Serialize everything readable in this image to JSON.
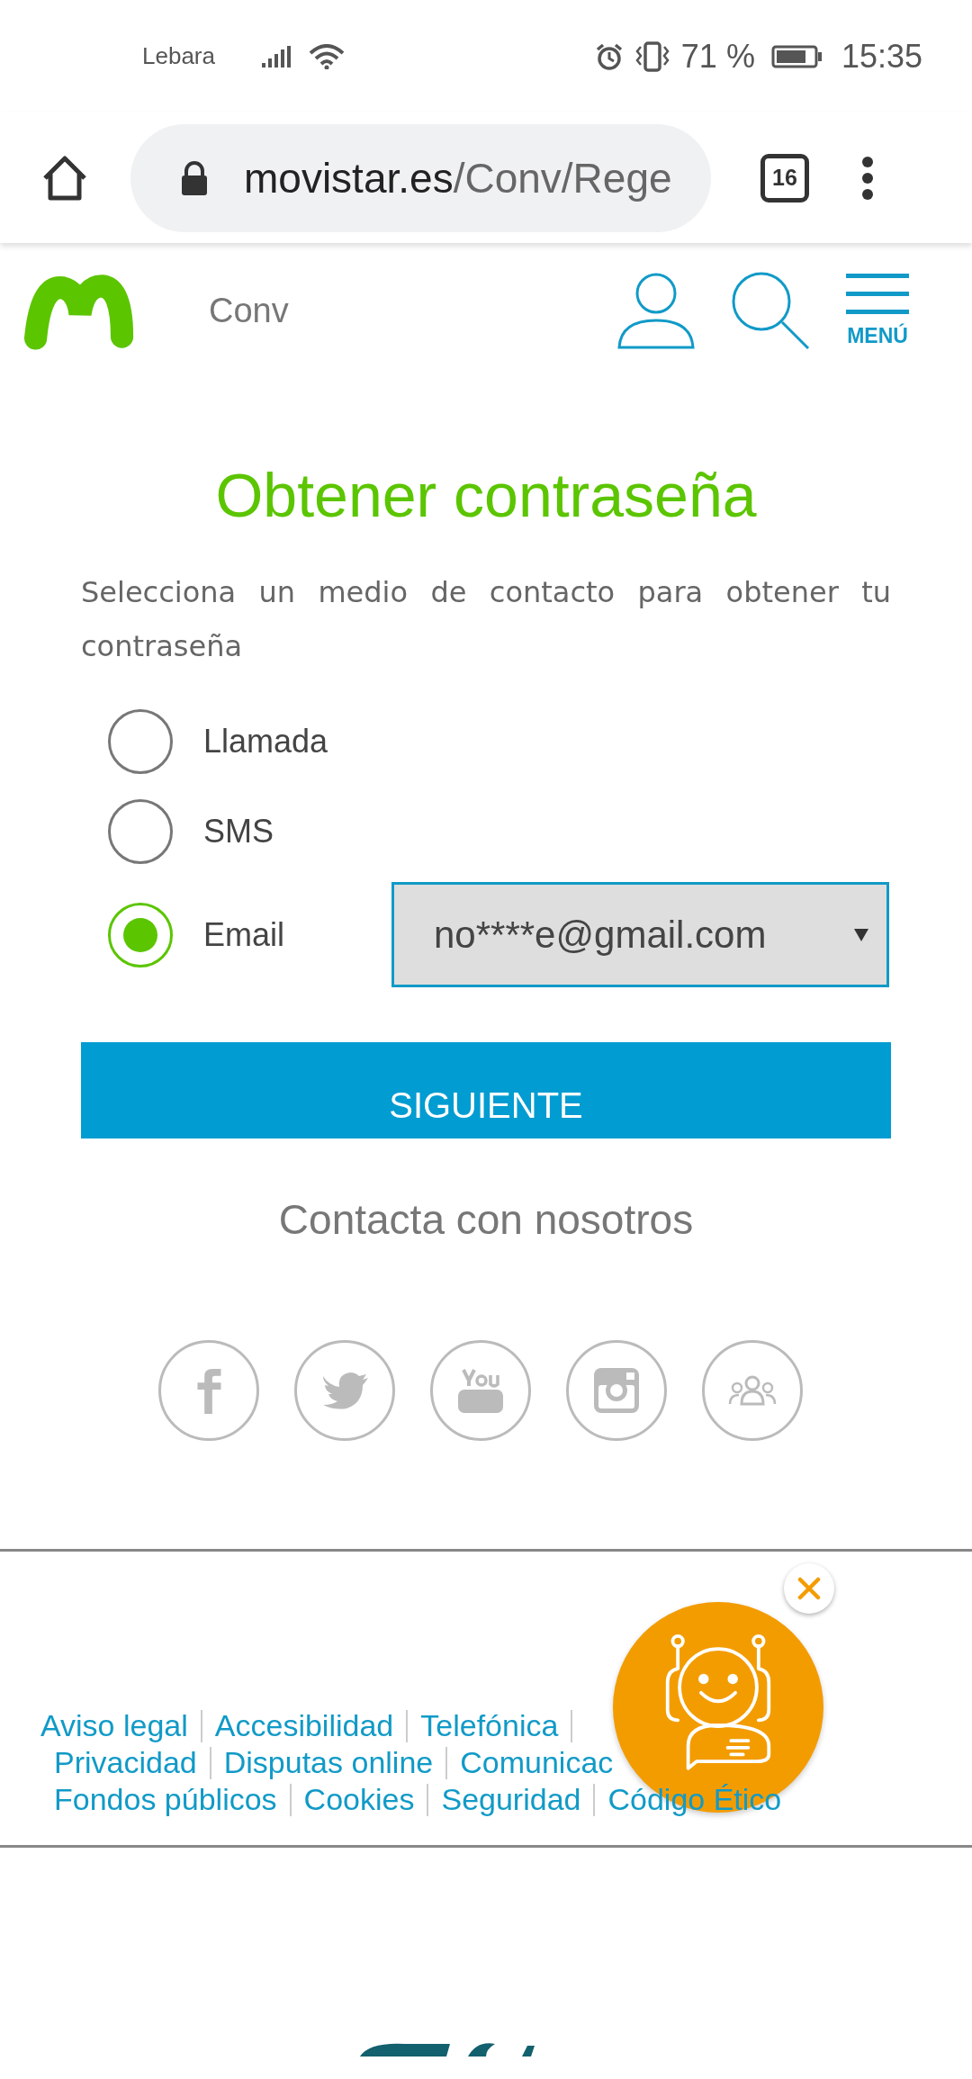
{
  "status_bar": {
    "carrier": "Lebara",
    "battery": "71 %",
    "time": "15:35"
  },
  "browser": {
    "url_host": "movistar.es",
    "url_path": "/Conv/Rege",
    "tab_count": "16"
  },
  "header": {
    "section": "Conv",
    "menu_label": "MENÚ"
  },
  "form": {
    "title": "Obtener contraseña",
    "description": "Selecciona un medio de contacto para obtener tu contraseña",
    "options": [
      {
        "label": "Llamada",
        "selected": false
      },
      {
        "label": "SMS",
        "selected": false
      },
      {
        "label": "Email",
        "selected": true
      }
    ],
    "email_select": {
      "value": "no****e@gmail.com"
    },
    "submit": "SIGUIENTE"
  },
  "contact": {
    "title": "Contacta con nosotros"
  },
  "footer": {
    "rows": [
      {
        "links": [
          "Aviso legal",
          "Accesibilidad",
          "Telefónica"
        ],
        "trailing_separator": true
      },
      {
        "links": [
          "Privacidad",
          "Disputas online",
          "Comunicac"
        ],
        "trailing_separator": false
      },
      {
        "links": [
          "Fondos públicos",
          "Cookies",
          "Seguridad",
          "Código Ético"
        ],
        "trailing_separator": false
      }
    ]
  }
}
